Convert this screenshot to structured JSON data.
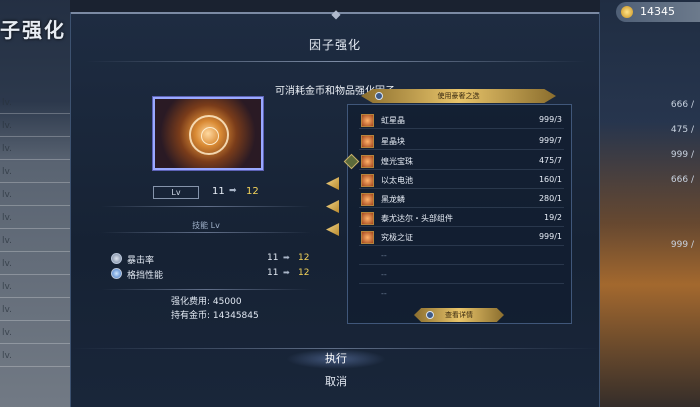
{
  "background": {
    "left_title": "子强化",
    "coin_display": "14345",
    "right_rows": [
      "666 /",
      "475 /",
      "999 /",
      "666 /",
      "999 /"
    ],
    "left_rows": [
      "lv.",
      "lv.",
      "lv.",
      "lv.",
      "lv.",
      "lv.",
      "lv.",
      "lv.",
      "lv.",
      "lv.",
      "lv.",
      "lv."
    ]
  },
  "dialog": {
    "title": "因子强化",
    "subtitle": "可消耗金币和物品强化因子",
    "factor": {
      "lv_label": "Lv",
      "lv_current": "11",
      "lv_arrow": "➡",
      "lv_next": "12"
    },
    "skill_header": "技能 Lv",
    "skills": [
      {
        "name": "暴击率",
        "current": "11",
        "arrow": "➡",
        "next": "12",
        "icon": "crit-icon"
      },
      {
        "name": "格挡性能",
        "current": "11",
        "arrow": "➡",
        "next": "12",
        "icon": "block-icon"
      }
    ],
    "cost_label": "强化费用:",
    "cost_value": "45000",
    "gold_label": "持有金币:",
    "gold_value": "14345845",
    "materials_header": "使用豪奢之选",
    "materials": [
      {
        "name": "虹星晶",
        "count": "999/3"
      },
      {
        "name": "星晶块",
        "count": "999/7"
      },
      {
        "name": "煌光宝珠",
        "count": "475/7"
      },
      {
        "name": "以太电池",
        "count": "160/1"
      },
      {
        "name": "黑龙鳞",
        "count": "280/1"
      },
      {
        "name": "泰尤达尔・头部组件",
        "count": "19/2"
      },
      {
        "name": "究极之证",
        "count": "999/1"
      }
    ],
    "empty_slots": [
      "--",
      "--",
      "--"
    ],
    "detail_button": "查看详情",
    "execute": "执行",
    "cancel": "取消"
  }
}
